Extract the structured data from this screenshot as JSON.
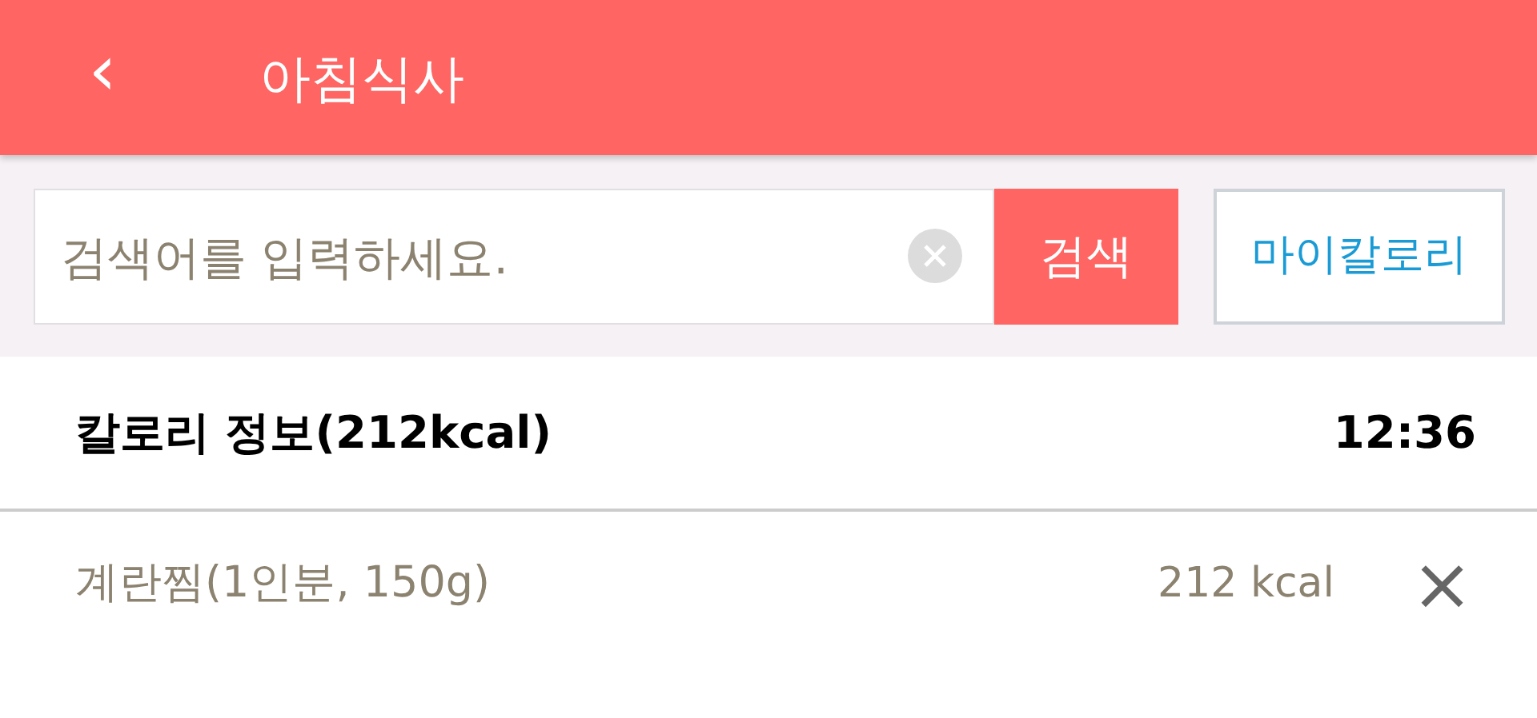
{
  "header": {
    "back": "‹",
    "title": "아침식사"
  },
  "search": {
    "placeholder": "검색어를 입력하세요.",
    "button": "검색",
    "my_calorie_button": "마이칼로리"
  },
  "summary": {
    "title": "칼로리 정보(212kcal)",
    "time": "12:36"
  },
  "foods": [
    {
      "name": "계란찜(1인분, 150g)",
      "calories": "212 kcal",
      "delete": "×"
    }
  ]
}
